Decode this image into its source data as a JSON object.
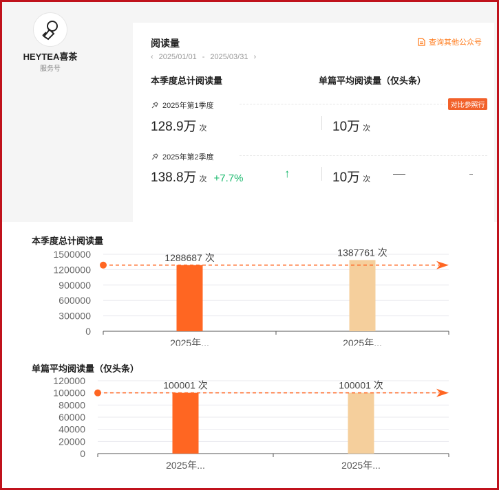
{
  "account": {
    "name": "HEYTEA喜茶",
    "type": "服务号",
    "avatar_icon": "heytea-logo-icon"
  },
  "card": {
    "title": "阅读量",
    "date_start": "2025/01/01",
    "date_sep": "-",
    "date_end": "2025/03/31",
    "query_link": "查询其他公众号",
    "col_total": "本季度总计阅读量",
    "col_avg": "单篇平均阅读量（仅头条）",
    "compare_button": "对比参照行",
    "rows": [
      {
        "label": "2025年第1季度",
        "total_value": "128.9万",
        "total_unit": "次",
        "avg_value": "10万",
        "avg_unit": "次",
        "growth": ""
      },
      {
        "label": "2025年第2季度",
        "total_value": "138.8万",
        "total_unit": "次",
        "avg_value": "10万",
        "avg_unit": "次",
        "growth": "+7.7%"
      }
    ]
  },
  "colors": {
    "accent_orange": "#ff6622",
    "bar_light": "#f5cf9c",
    "growth_green": "#18b86b",
    "compare_red": "#f2612a"
  },
  "chart_data": [
    {
      "type": "bar",
      "title": "本季度总计阅读量",
      "categories": [
        "2025年...",
        "2025年..."
      ],
      "values": [
        1288687,
        1387761
      ],
      "data_labels": [
        "1288687 次",
        "1387761 次"
      ],
      "bar_colors": [
        "#ff6622",
        "#f5cf9c"
      ],
      "yticks": [
        0,
        300000,
        600000,
        900000,
        1200000,
        1500000
      ],
      "ylim": [
        0,
        1500000
      ],
      "reference_line": 1288687,
      "grid": true
    },
    {
      "type": "bar",
      "title": "单篇平均阅读量（仅头条）",
      "categories": [
        "2025年...",
        "2025年..."
      ],
      "values": [
        100001,
        100001
      ],
      "data_labels": [
        "100001 次",
        "100001 次"
      ],
      "bar_colors": [
        "#ff6622",
        "#f5cf9c"
      ],
      "yticks": [
        0,
        20000,
        40000,
        60000,
        80000,
        100000,
        120000
      ],
      "ylim": [
        0,
        120000
      ],
      "reference_line": 100001,
      "grid": true
    }
  ]
}
